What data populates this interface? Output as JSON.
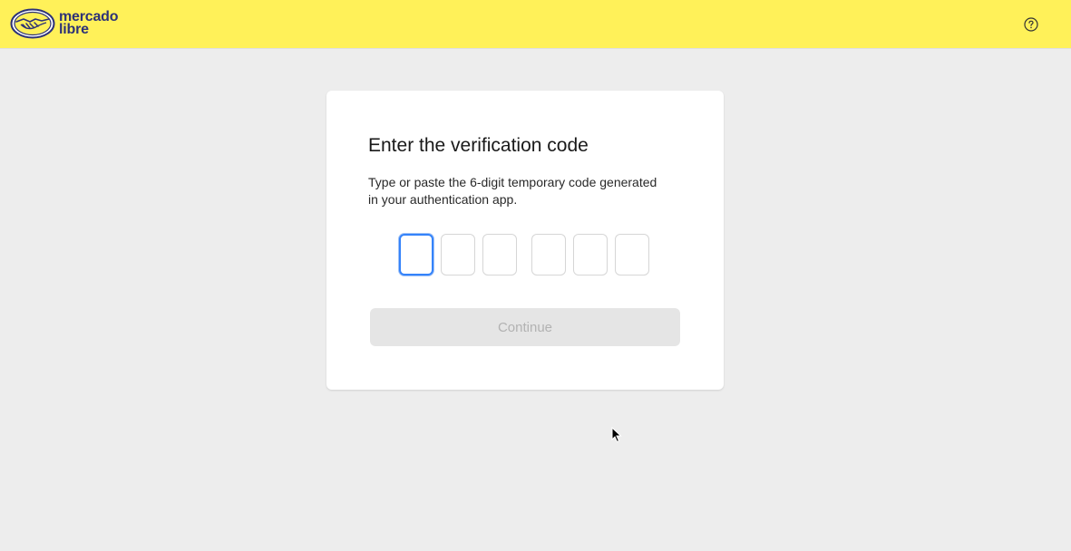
{
  "header": {
    "logo_line1": "mercado",
    "logo_line2": "libre",
    "help_icon": "question-circle-icon"
  },
  "card": {
    "title": "Enter the verification code",
    "description": "Type or paste the 6-digit temporary code generated in your authentication app.",
    "code_digits": [
      "",
      "",
      "",
      "",
      "",
      ""
    ],
    "focused_digit_index": 0,
    "continue_label": "Continue",
    "continue_enabled": false
  },
  "colors": {
    "header_bg": "#fff159",
    "page_bg": "#ededed",
    "brand_text": "#2d3277",
    "focus_blue": "#3483fa",
    "disabled_button_bg": "#e5e5e5",
    "disabled_button_text": "#b2b2b2"
  }
}
